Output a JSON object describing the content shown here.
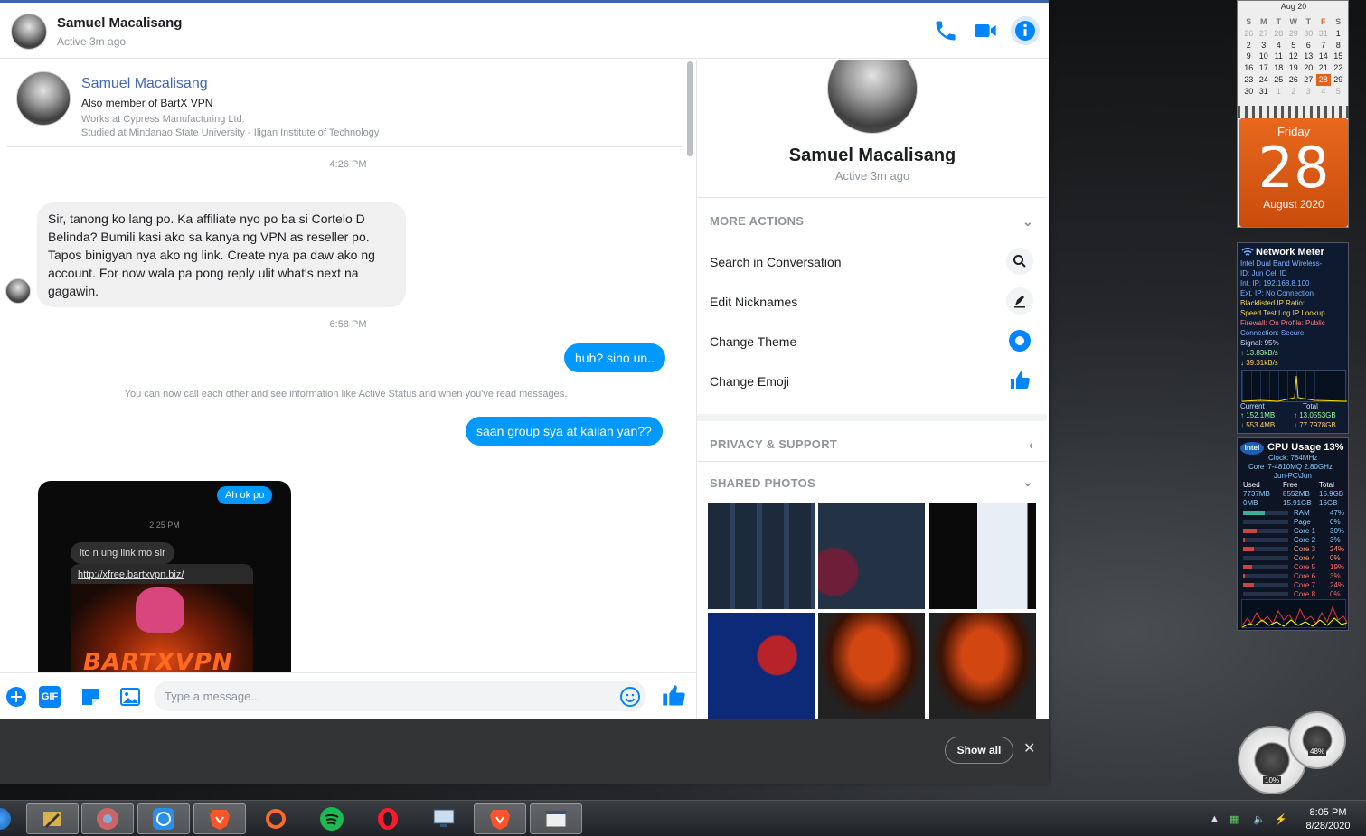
{
  "header": {
    "name": "Samuel Macalisang",
    "status": "Active 3m ago"
  },
  "profile_card": {
    "name": "Samuel Macalisang",
    "line1": "Also member of BartX VPN",
    "line2": "Works at Cypress Manufacturing Ltd.",
    "line3": "Studied at Mindanao State University - Iligan Institute of Technology"
  },
  "messages": {
    "time1": "4:26 PM",
    "incoming1": "Sir, tanong ko lang po. Ka affiliate nyo po ba si Cortelo D Belinda? Bumili kasi ako sa kanya ng VPN as reseller po. Tapos binigyan nya ako ng link. Create nya pa daw ako ng account. For now wala pa pong reply ulit what's next na gagawin.",
    "time2": "6:58 PM",
    "outgoing1": "huh? sino un..",
    "system_note": "You can now call each other and see information like Active Status and when you've read messages.",
    "outgoing2": "saan group sya at kailan yan??"
  },
  "shared_image": {
    "pill": "Ah ok po",
    "time": "2:25 PM",
    "message": "ito n ung link mo sir",
    "link": "http://xfree.bartxvpn.biz/",
    "art_text": "BARTXVPN"
  },
  "composer": {
    "placeholder": "Type a message...",
    "gif_label": "GIF"
  },
  "panel": {
    "name": "Samuel Macalisang",
    "status": "Active 3m ago",
    "more_actions": "MORE ACTIONS",
    "actions": [
      "Search in Conversation",
      "Edit Nicknames",
      "Change Theme",
      "Change Emoji"
    ],
    "privacy": "PRIVACY & SUPPORT",
    "shared_photos": "SHARED PHOTOS"
  },
  "downloads_bar": {
    "show_all": "Show all",
    "close": "✕"
  },
  "calendar": {
    "month_nav": "Aug 20",
    "weekdays": [
      "S",
      "M",
      "T",
      "W",
      "T",
      "F",
      "S"
    ],
    "weeks": [
      [
        "26",
        "27",
        "28",
        "29",
        "30",
        "31",
        "1"
      ],
      [
        "2",
        "3",
        "4",
        "5",
        "6",
        "7",
        "8"
      ],
      [
        "9",
        "10",
        "11",
        "12",
        "13",
        "14",
        "15"
      ],
      [
        "16",
        "17",
        "18",
        "19",
        "20",
        "21",
        "22"
      ],
      [
        "23",
        "24",
        "25",
        "26",
        "27",
        "28",
        "29"
      ],
      [
        "30",
        "31",
        "1",
        "2",
        "3",
        "4",
        "5"
      ]
    ],
    "today": "28",
    "day_name": "Friday",
    "day_number": "28",
    "month_year": "August 2020"
  },
  "network_meter": {
    "title": "Network Meter",
    "lines": [
      "Intel Dual Band Wireless-",
      "ID: Jun Cell ID",
      "Int. IP: 192.168.8.100",
      "Ext. IP: No Connection",
      "Blacklisted IP Ratio:",
      "Speed Test   Log   IP Lookup",
      "Firewall: On    Profile: Public",
      "Connection: Secure",
      "Signal: 95%",
      "↑ 13.83kB/s",
      "↓ 39.31kB/s"
    ],
    "current_label": "Current",
    "total_label": "Total",
    "current_up": "↑ 152.1MB",
    "current_down": "↓ 553.4MB",
    "total_up": "↑ 13.0553GB",
    "total_down": "↓ 77.7978GB"
  },
  "cpu_meter": {
    "title": "CPU Usage  13%",
    "clock": "Clock: 784MHz",
    "cpu_name": "Core i7-4810MQ 2.80GHz",
    "host": "Jun-PC\\Jun",
    "mem_headers": [
      "Used",
      "Free",
      "Total"
    ],
    "mem_row1": [
      "7737MB",
      "8552MB",
      "15.9GB"
    ],
    "mem_row2": [
      "0MB",
      "15.91GB",
      "16GB"
    ],
    "rows": [
      {
        "label": "RAM",
        "value": "47%"
      },
      {
        "label": "Page",
        "value": "0%"
      },
      {
        "label": "Core 1",
        "value": "30%"
      },
      {
        "label": "Core 2",
        "value": "3%"
      },
      {
        "label": "Core 3",
        "value": "24%"
      },
      {
        "label": "Core 4",
        "value": "0%"
      },
      {
        "label": "Core 5",
        "value": "19%"
      },
      {
        "label": "Core 6",
        "value": "3%"
      },
      {
        "label": "Core 7",
        "value": "24%"
      },
      {
        "label": "Core 8",
        "value": "0%"
      }
    ]
  },
  "gauges": {
    "left_value": "10%",
    "right_value": "48%"
  },
  "taskbar": {
    "time": "8:05 PM",
    "date": "8/28/2020"
  }
}
